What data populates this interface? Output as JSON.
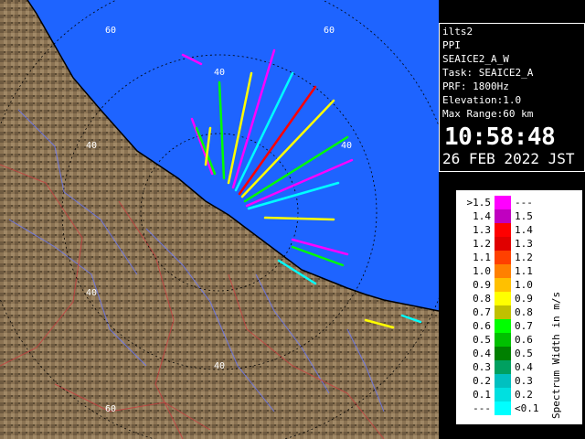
{
  "info": {
    "radar": "ilts2",
    "product": "PPI",
    "scan": "SEAICE2_A_W",
    "task": "Task: SEAICE2_A",
    "prf": "PRF: 1800Hz",
    "elevation": "Elevation:1.0",
    "max_range": "Max Range:60 km",
    "time": "10:58:48",
    "date": "26 FEB 2022 JST"
  },
  "ring_labels": [
    "60",
    "60",
    "40",
    "40",
    "40",
    "40",
    "40",
    "60"
  ],
  "colors": {
    "sea": "#1e64ff",
    "land": "#8b7353",
    "coastline": "#000000",
    "range_rings": "#000000"
  },
  "legend": {
    "title": "Spectrum Width in m/s",
    "rows": [
      {
        "lo": ">1.5",
        "hi": "---",
        "color": "#ff00ff"
      },
      {
        "lo": "1.4",
        "hi": "1.5",
        "color": "#c000c0"
      },
      {
        "lo": "1.3",
        "hi": "1.4",
        "color": "#ff0000"
      },
      {
        "lo": "1.2",
        "hi": "1.3",
        "color": "#e00000"
      },
      {
        "lo": "1.1",
        "hi": "1.2",
        "color": "#ff4000"
      },
      {
        "lo": "1.0",
        "hi": "1.1",
        "color": "#ff8000"
      },
      {
        "lo": "0.9",
        "hi": "1.0",
        "color": "#ffc000"
      },
      {
        "lo": "0.8",
        "hi": "0.9",
        "color": "#ffff00"
      },
      {
        "lo": "0.7",
        "hi": "0.8",
        "color": "#c0c000"
      },
      {
        "lo": "0.6",
        "hi": "0.7",
        "color": "#00ff00"
      },
      {
        "lo": "0.5",
        "hi": "0.6",
        "color": "#00c000"
      },
      {
        "lo": "0.4",
        "hi": "0.5",
        "color": "#008000"
      },
      {
        "lo": "0.3",
        "hi": "0.4",
        "color": "#00a060"
      },
      {
        "lo": "0.2",
        "hi": "0.3",
        "color": "#00c0c0"
      },
      {
        "lo": "0.1",
        "hi": "0.2",
        "color": "#00e0e0"
      },
      {
        "lo": "---",
        "hi": "<0.1",
        "color": "#00ffff"
      }
    ]
  }
}
